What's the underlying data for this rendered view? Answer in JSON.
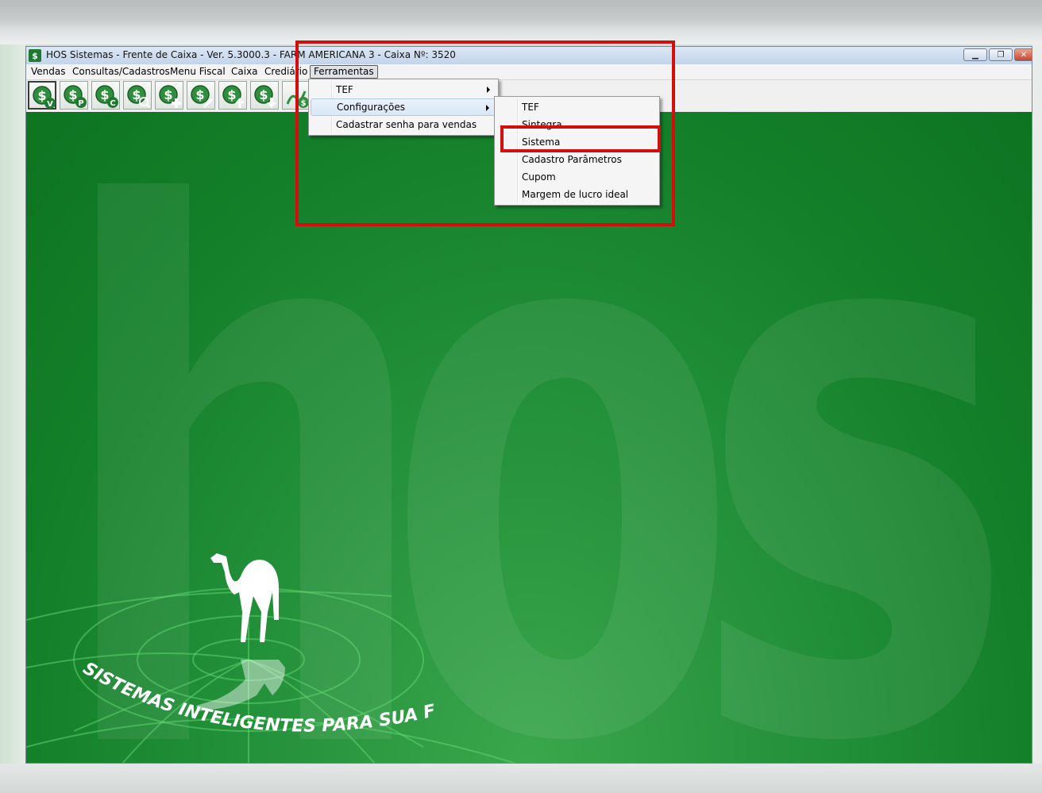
{
  "window": {
    "title": "HOS Sistemas - Frente de Caixa - Ver. 5.3000.3 - FARM AMERICANA 3 - Caixa Nº: 3520"
  },
  "menubar": {
    "items": [
      "Vendas",
      "Consultas/Cadastros",
      "Menu Fiscal",
      "Caixa",
      "Crediário",
      "Ferramentas"
    ],
    "active": "Ferramentas"
  },
  "toolbar": {
    "buttons": [
      {
        "icon": "dollar-v-icon",
        "letter": "V"
      },
      {
        "icon": "dollar-p-icon",
        "letter": "P"
      },
      {
        "icon": "dollar-c-icon",
        "letter": "C"
      },
      {
        "icon": "dollar-search-icon",
        "letter": ""
      },
      {
        "icon": "dollar-plus-icon",
        "letter": ""
      },
      {
        "icon": "dollar-edit-icon",
        "letter": ""
      },
      {
        "icon": "dollar-up-icon",
        "letter": ""
      },
      {
        "icon": "dollar-down-icon",
        "letter": ""
      },
      {
        "icon": "dollar-exit-icon",
        "letter": ""
      }
    ]
  },
  "ferramentas_menu": {
    "items": [
      {
        "label": "TEF",
        "submenu": true
      },
      {
        "label": "Configurações",
        "submenu": true
      },
      {
        "label": "Cadastrar senha para vendas",
        "submenu": false
      }
    ]
  },
  "configuracoes_submenu": {
    "items": [
      "TEF",
      "Sintegra",
      "Sistema",
      "Cadastro Parâmetros",
      "Cupom",
      "Margem de lucro ideal"
    ]
  },
  "background": {
    "brand": "hos",
    "slogan": "SISTEMAS INTELIGENTES PARA SUA FARMÁCIA"
  },
  "colors": {
    "highlight": "#d40d0d",
    "brand_green": "#14802a"
  }
}
